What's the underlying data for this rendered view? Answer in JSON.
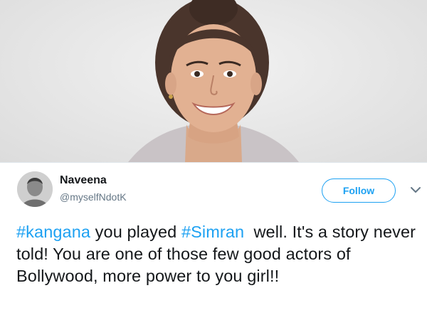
{
  "user": {
    "name": "Naveena",
    "handle": "@myselfNdotK"
  },
  "follow_label": "Follow",
  "tweet": {
    "hashtag_1": "#kangana",
    "text_1": " you played ",
    "hashtag_2": "#Simran",
    "text_2": "  well. It's a story never told! You are one of those few good actors of Bollywood, more power to you girl!!"
  },
  "icons": {
    "more": "chevron-down-icon"
  },
  "colors": {
    "link": "#1da1f2",
    "text": "#14171a",
    "muted": "#657786",
    "border": "#e1e8ed"
  }
}
